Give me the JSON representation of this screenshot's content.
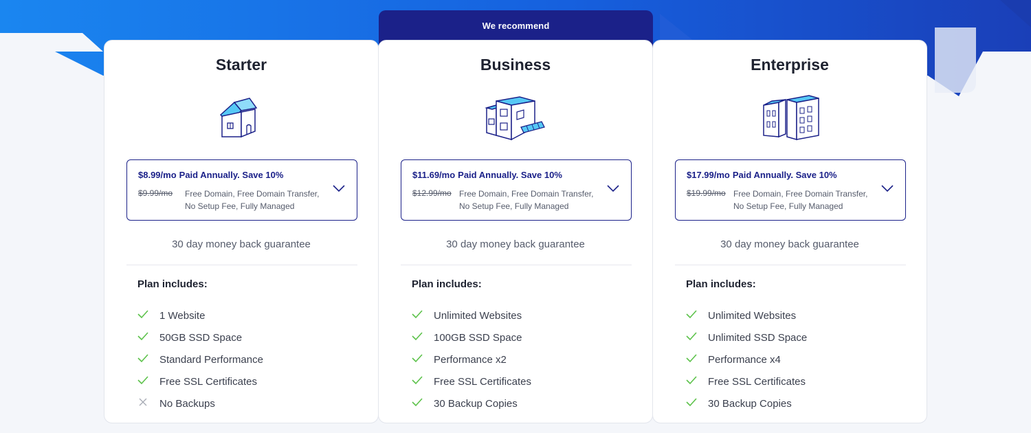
{
  "ribbon": {
    "label": "We recommend"
  },
  "colors": {
    "brand": "#1b2189",
    "check": "#5cc24a",
    "hero_blue": "#1565e0"
  },
  "plans": [
    {
      "name": "Starter",
      "icon": "house-icon",
      "price": "$8.99/mo",
      "billing_note": "Paid Annually. Save 10%",
      "old_price": "$9.99/mo",
      "perks_line1": "Free Domain, Free Domain Transfer,",
      "perks_line2": "No Setup Fee, Fully Managed",
      "guarantee": "30 day money back guarantee",
      "includes_label": "Plan includes:",
      "features": [
        {
          "label": "1 Website",
          "included": true
        },
        {
          "label": "50GB SSD Space",
          "included": true
        },
        {
          "label": "Standard Performance",
          "included": true
        },
        {
          "label": "Free SSL Certificates",
          "included": true
        },
        {
          "label": "No Backups",
          "included": false
        }
      ]
    },
    {
      "name": "Business",
      "icon": "shop-building-icon",
      "price": "$11.69/mo",
      "billing_note": "Paid Annually. Save 10%",
      "old_price": "$12.99/mo",
      "perks_line1": "Free Domain, Free Domain Transfer,",
      "perks_line2": "No Setup Fee, Fully Managed",
      "guarantee": "30 day money back guarantee",
      "includes_label": "Plan includes:",
      "features": [
        {
          "label": "Unlimited Websites",
          "included": true
        },
        {
          "label": "100GB SSD Space",
          "included": true
        },
        {
          "label": "Performance x2",
          "included": true
        },
        {
          "label": "Free SSL Certificates",
          "included": true
        },
        {
          "label": "30 Backup Copies",
          "included": true
        }
      ]
    },
    {
      "name": "Enterprise",
      "icon": "office-towers-icon",
      "price": "$17.99/mo",
      "billing_note": "Paid Annually. Save 10%",
      "old_price": "$19.99/mo",
      "perks_line1": "Free Domain, Free Domain Transfer,",
      "perks_line2": "No Setup Fee, Fully Managed",
      "guarantee": "30 day money back guarantee",
      "includes_label": "Plan includes:",
      "features": [
        {
          "label": "Unlimited Websites",
          "included": true
        },
        {
          "label": "Unlimited SSD Space",
          "included": true
        },
        {
          "label": "Performance x4",
          "included": true
        },
        {
          "label": "Free SSL Certificates",
          "included": true
        },
        {
          "label": "30 Backup Copies",
          "included": true
        }
      ]
    }
  ]
}
